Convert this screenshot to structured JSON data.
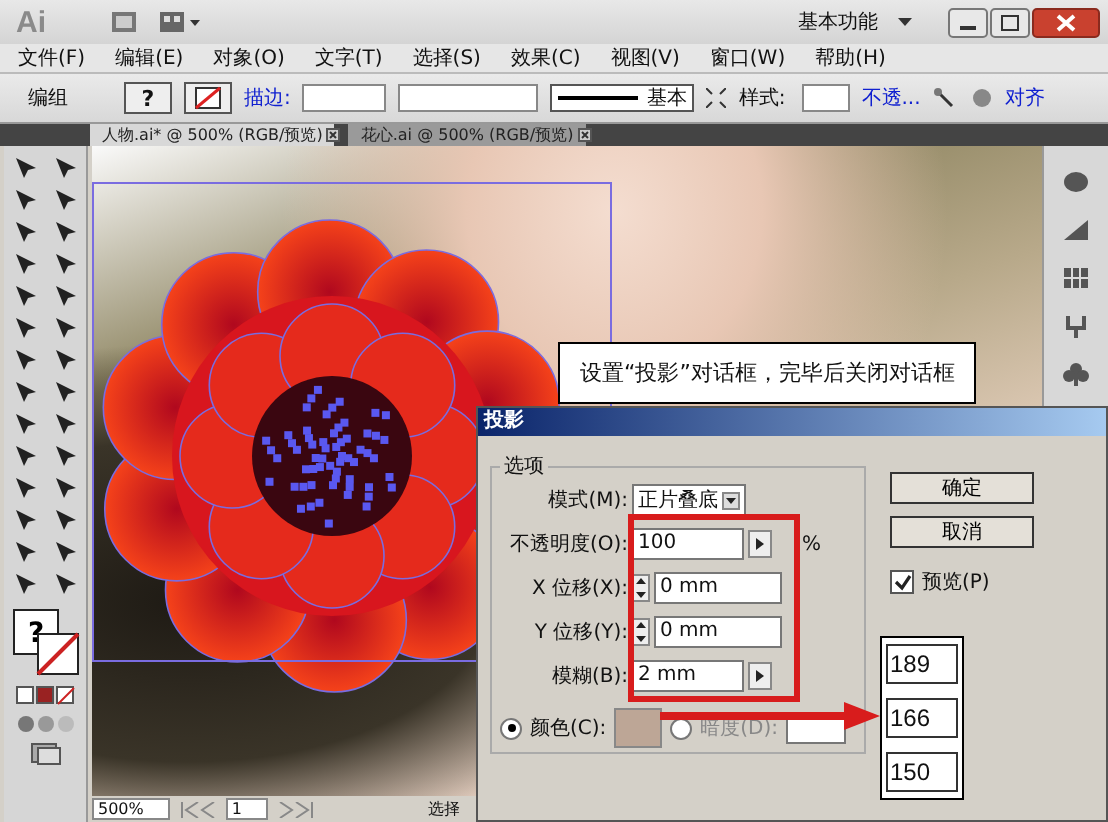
{
  "window": {
    "app_logo": "Ai",
    "workspace": "基本功能"
  },
  "menu": [
    "文件(F)",
    "编辑(E)",
    "对象(O)",
    "文字(T)",
    "选择(S)",
    "效果(C)",
    "视图(V)",
    "窗口(W)",
    "帮助(H)"
  ],
  "control_bar": {
    "selection": "编组",
    "fill_value": "?",
    "stroke_label": "描边:",
    "stroke_profile": "基本",
    "style_label": "样式:",
    "opacity_link": "不透...",
    "align_link": "对齐"
  },
  "doc_tabs": [
    {
      "label": "人物.ai* @ 500% (RGB/预览)",
      "selected": true
    },
    {
      "label": "花心.ai @ 500% (RGB/预览)",
      "selected": false
    }
  ],
  "callout": "设置“投影”对话框，完毕后关闭对话框",
  "toolbox": {
    "fill_value": "?"
  },
  "status_bar": {
    "zoom": "500%",
    "page": "1",
    "status": "选择"
  },
  "dialog": {
    "title": "投影",
    "group_label": "选项",
    "fields": [
      {
        "kind": "dropdown",
        "label": "模式(M):",
        "value": "正片叠底"
      },
      {
        "kind": "slider",
        "label": "不透明度(O):",
        "value": "100",
        "unit": "%"
      },
      {
        "kind": "spin",
        "label": "X 位移(X):",
        "value": "0 mm"
      },
      {
        "kind": "spin",
        "label": "Y 位移(Y):",
        "value": "0 mm"
      },
      {
        "kind": "slider",
        "label": "模糊(B):",
        "value": "2 mm"
      }
    ],
    "color_option": {
      "label": "颜色(C):",
      "selected": true,
      "color": "#bda696"
    },
    "darkness_option": {
      "label": "暗度(D):",
      "selected": false
    },
    "buttons": [
      "确定",
      "取消"
    ],
    "preview": {
      "label": "预览(P)",
      "checked": true
    }
  },
  "color_values": [
    "189",
    "166",
    "150"
  ]
}
